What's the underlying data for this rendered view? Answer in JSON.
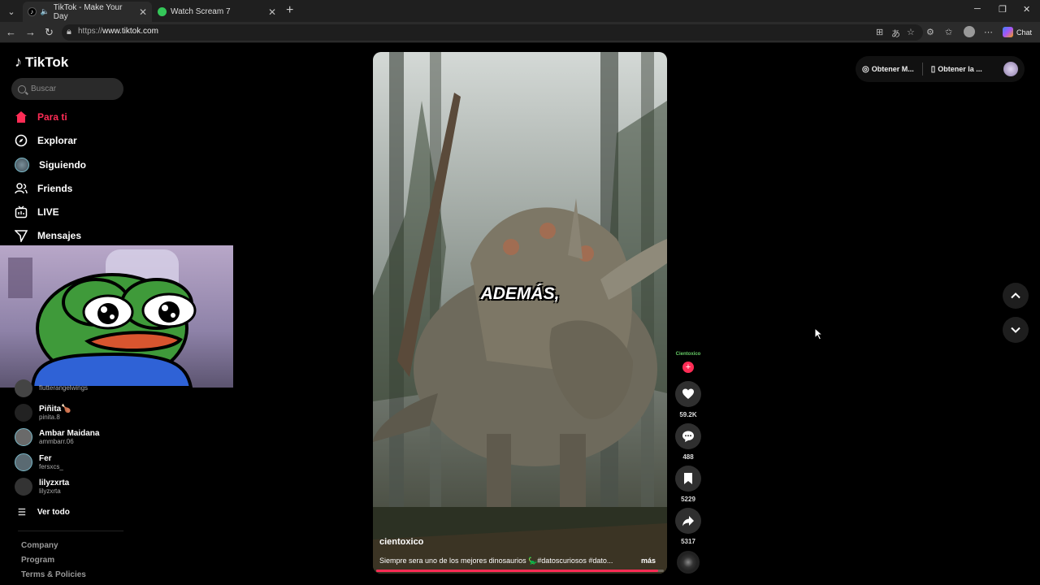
{
  "browser": {
    "tabs": [
      {
        "title": "TikTok - Make Your Day",
        "active": true
      },
      {
        "title": "Watch Scream 7",
        "active": false
      }
    ],
    "url_prefix": "https://",
    "url_host": "www.tiktok.com",
    "chat_label": "Chat"
  },
  "tiktok": {
    "logo": "TikTok",
    "search_placeholder": "Buscar",
    "nav": [
      {
        "label": "Para ti",
        "icon": "home-icon",
        "active": true
      },
      {
        "label": "Explorar",
        "icon": "compass-icon"
      },
      {
        "label": "Siguiendo",
        "icon": "avatar"
      },
      {
        "label": "Friends",
        "icon": "friends-icon"
      },
      {
        "label": "LIVE",
        "icon": "live-icon"
      },
      {
        "label": "Mensajes",
        "icon": "send-icon"
      }
    ],
    "following": [
      {
        "name": "",
        "handle": "flutterangelwings"
      },
      {
        "name": "Piñita🍗",
        "handle": "pinita.8"
      },
      {
        "name": "Ambar Maidana",
        "handle": "ammbarr.06"
      },
      {
        "name": "Fer",
        "handle": "fersxcs_"
      },
      {
        "name": "lilyzxrta",
        "handle": "lilyzxrta"
      }
    ],
    "see_all": "Ver todo",
    "footer": [
      "Company",
      "Program",
      "Terms & Policies"
    ],
    "top_actions": {
      "get_coins": "Obtener M...",
      "get_app": "Obtener la ..."
    },
    "video": {
      "caption": "ADEMÁS,",
      "author": "cientoxico",
      "description": "Siempre sera uno de los mejores dinosaurios 🦕#datoscuriosos #dato...",
      "more": "más",
      "progress": 0.98,
      "avatar_text": "Cientoxico",
      "likes": "59.2K",
      "comments": "488",
      "saves": "5229",
      "shares": "5317"
    }
  }
}
